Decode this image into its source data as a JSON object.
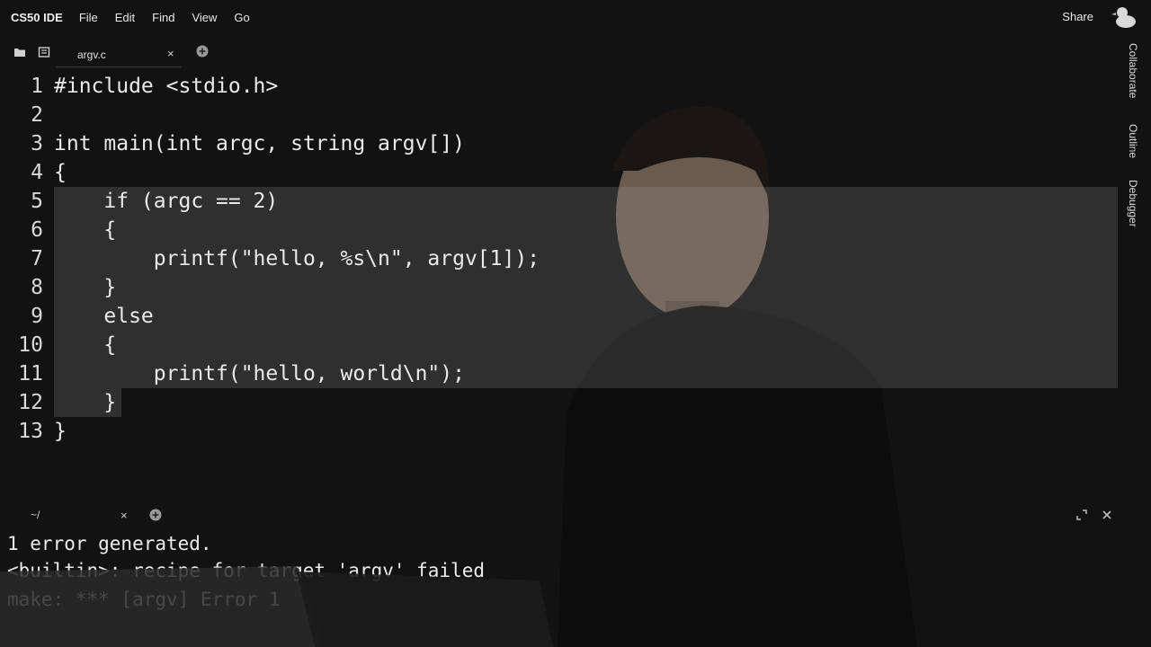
{
  "app": {
    "brand": "CS50 IDE",
    "menu": [
      "File",
      "Edit",
      "Find",
      "View",
      "Go"
    ],
    "share_label": "Share"
  },
  "tabs": [
    {
      "label": "argv.c",
      "close": "×"
    }
  ],
  "side_panel": [
    "Collaborate",
    "Outline",
    "Debugger"
  ],
  "editor": {
    "lines": [
      {
        "n": "1",
        "text": "#include <stdio.h>"
      },
      {
        "n": "2",
        "text": ""
      },
      {
        "n": "3",
        "text": "int main(int argc, string argv[])"
      },
      {
        "n": "4",
        "text": "{"
      },
      {
        "n": "5",
        "text": "    if (argc == 2)"
      },
      {
        "n": "6",
        "text": "    {"
      },
      {
        "n": "7",
        "text": "        printf(\"hello, %s\\n\", argv[1]);"
      },
      {
        "n": "8",
        "text": "    }"
      },
      {
        "n": "9",
        "text": "    else"
      },
      {
        "n": "10",
        "text": "    {"
      },
      {
        "n": "11",
        "text": "        printf(\"hello, world\\n\");"
      },
      {
        "n": "12",
        "text": "    }"
      },
      {
        "n": "13",
        "text": "}"
      }
    ]
  },
  "terminal": {
    "tab_label": "~/",
    "close": "×",
    "lines": [
      "1 error generated.",
      "<builtin>: recipe for target 'argv' failed",
      "make: *** [argv] Error 1"
    ]
  },
  "colors": {
    "background": "#121212",
    "text": "#e6e6e6",
    "selection": "#2f2f2f"
  }
}
